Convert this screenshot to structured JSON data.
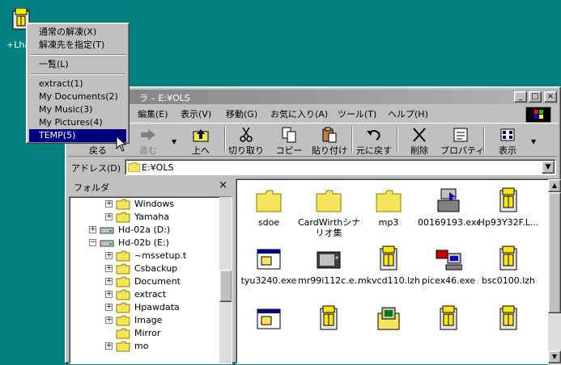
{
  "desktop": {
    "icon_label": "+Lha",
    "icon_name": "lha-archive-icon"
  },
  "window": {
    "title": "ラ – E:¥OLS",
    "minimize": "_",
    "maximize": "□",
    "close": "×",
    "menu": [
      {
        "label": "編集(E)"
      },
      {
        "label": "表示(V)"
      },
      {
        "label": "移動(G)"
      },
      {
        "label": "お気に入り(A)"
      },
      {
        "label": "ツール(T)"
      },
      {
        "label": "ヘルプ(H)"
      }
    ],
    "toolbar": {
      "back": "戻る",
      "forward": "進む",
      "up": "上へ",
      "cut": "切り取り",
      "copy": "コピー",
      "paste": "貼り付け",
      "undo": "元に戻す",
      "delete": "削除",
      "properties": "プロパティ",
      "view": "表示"
    },
    "address": {
      "label": "アドレス(D)",
      "value": "E:¥OLS"
    }
  },
  "folder_pane": {
    "title": "フォルダ",
    "close": "×",
    "tree": [
      {
        "label": "Windows",
        "expand": "+",
        "type": "folder"
      },
      {
        "label": "Yamaha",
        "expand": "+",
        "type": "folder"
      },
      {
        "label": "Hd-02a (D:)",
        "expand": "+",
        "type": "drive"
      },
      {
        "label": "Hd-02b (E:)",
        "expand": "−",
        "type": "drive"
      },
      {
        "label": "~mssetup.t",
        "expand": "+",
        "type": "folder"
      },
      {
        "label": "Csbackup",
        "expand": "+",
        "type": "folder"
      },
      {
        "label": "Document",
        "expand": "+",
        "type": "folder"
      },
      {
        "label": "extract",
        "expand": "+",
        "type": "folder"
      },
      {
        "label": "Hpawdata",
        "expand": "+",
        "type": "folder"
      },
      {
        "label": "Image",
        "expand": "+",
        "type": "folder"
      },
      {
        "label": "Mirror",
        "expand": "",
        "type": "folder"
      },
      {
        "label": "mo",
        "expand": "+",
        "type": "folder"
      }
    ]
  },
  "files": [
    {
      "label": "sdoe",
      "icon": "folder-icon"
    },
    {
      "label": "CardWirthシナ",
      "label2": "リオ集",
      "icon": "folder-icon"
    },
    {
      "label": "mp3",
      "icon": "folder-icon"
    },
    {
      "label": "00169193.exe",
      "icon": "installer-icon"
    },
    {
      "label": "Hp93Y32F.L...",
      "icon": "lzh-archive-icon"
    },
    {
      "label": "tyu3240.exe",
      "icon": "program-icon"
    },
    {
      "label": "mr99i112c.e...",
      "icon": "tv-program-icon"
    },
    {
      "label": "mkvcd110.lzh",
      "icon": "lzh-archive-icon"
    },
    {
      "label": "picex46.exe",
      "icon": "computer-program-icon"
    },
    {
      "label": "bsc0100.lzh",
      "icon": "lzh-archive-icon"
    },
    {
      "label": "",
      "icon": "program-icon"
    },
    {
      "label": "",
      "icon": "lzh-archive-icon"
    },
    {
      "label": "",
      "icon": "folder-archive-icon"
    },
    {
      "label": "",
      "icon": "lzh-archive-icon"
    },
    {
      "label": "",
      "icon": "lzh-archive-icon"
    }
  ],
  "context_menu": {
    "items": [
      {
        "label": "通常の解凍(X)"
      },
      {
        "label": "解凍先を指定(T)"
      },
      {
        "label": "一覧(L)"
      },
      {
        "label": "extract(1)"
      },
      {
        "label": "My Documents(2)"
      },
      {
        "label": "My Music(3)"
      },
      {
        "label": "My Pictures(4)"
      },
      {
        "label": "TEMP(5)",
        "selected": true
      }
    ]
  },
  "colors": {
    "desktop": "#008080",
    "selection": "#000080",
    "face": "#c0c0c0",
    "folder": "#f7e45a"
  }
}
